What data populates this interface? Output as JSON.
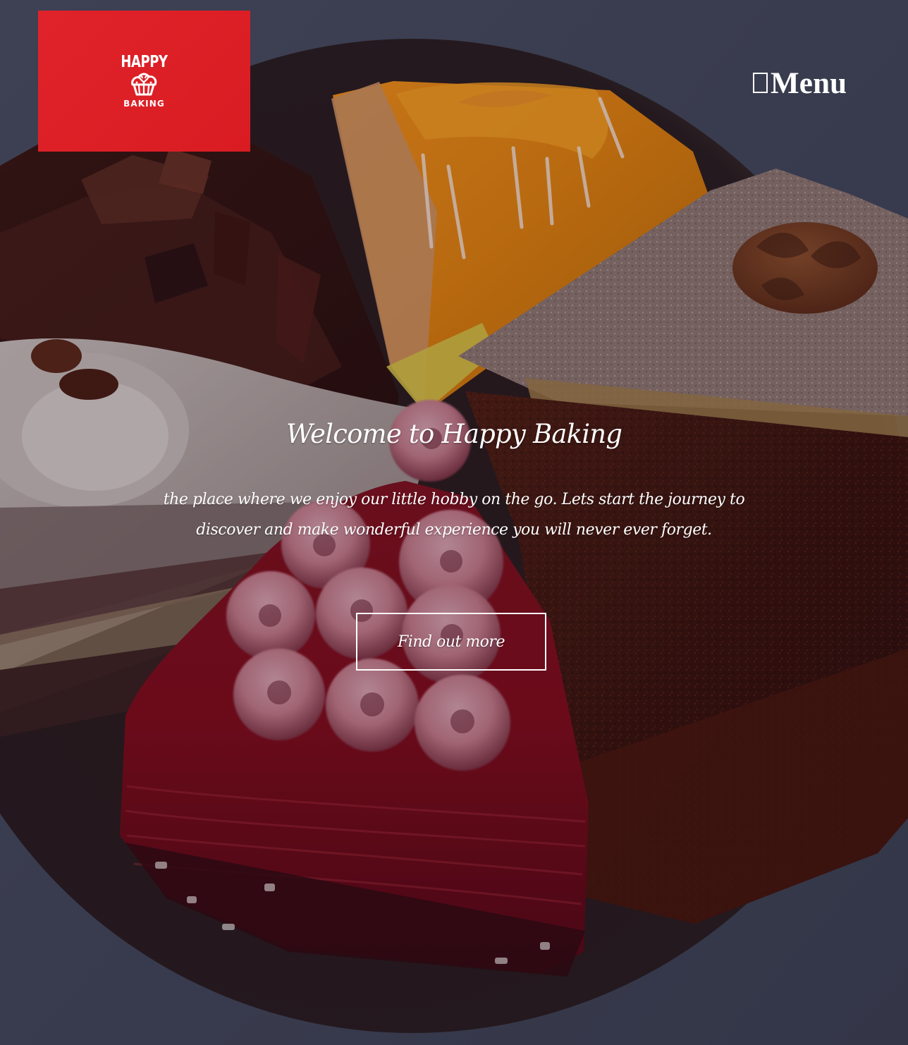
{
  "logo": {
    "top_text": "HAPPY",
    "bottom_text": "BAKING",
    "icon": "cupcake-icon",
    "background_color": "#dd1f26"
  },
  "header": {
    "menu_label": "Menu",
    "menu_icon": "hamburger-icon"
  },
  "hero": {
    "title": "Welcome to Happy Baking",
    "description": "the place where we enjoy our little hobby on the go. Lets start the journey to discover and make wonderful experience you will never ever forget.",
    "cta_label": "Find out more",
    "background_image": "cake-slices-photo"
  }
}
